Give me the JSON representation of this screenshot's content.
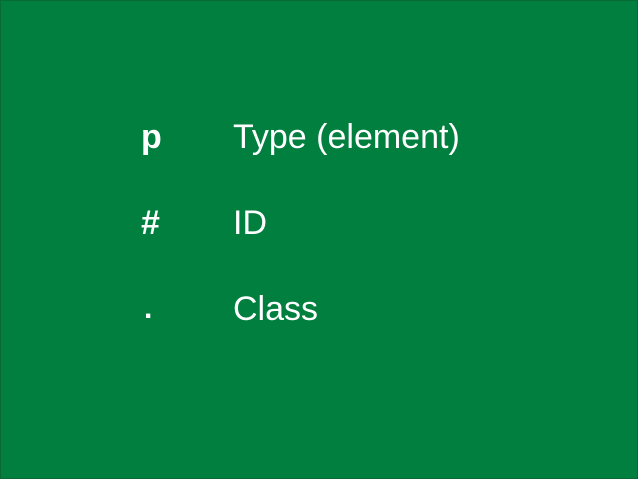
{
  "slide": {
    "background_color": "#007f3f",
    "text_color": "#ffffff",
    "rows": [
      {
        "symbol": "p",
        "label": "Type (element)"
      },
      {
        "symbol": "#",
        "label": "ID"
      },
      {
        "symbol": ".",
        "label": "Class"
      }
    ]
  }
}
